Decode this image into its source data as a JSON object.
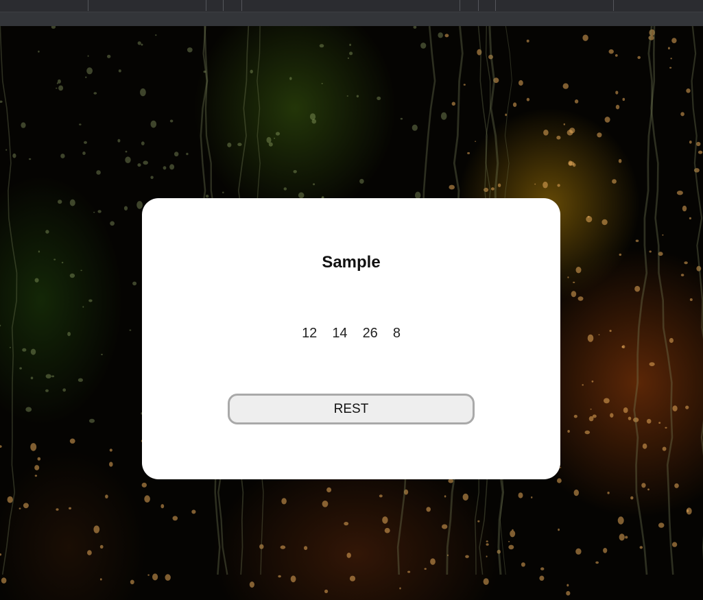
{
  "card": {
    "title": "Sample",
    "numbers": [
      "12",
      "14",
      "26",
      "8"
    ],
    "button_label": "REST"
  },
  "colors": {
    "toolbar_bg": "#2b2c30",
    "card_bg": "#ffffff",
    "button_bg": "#eeeeee",
    "button_border": "#a9a9a9"
  }
}
